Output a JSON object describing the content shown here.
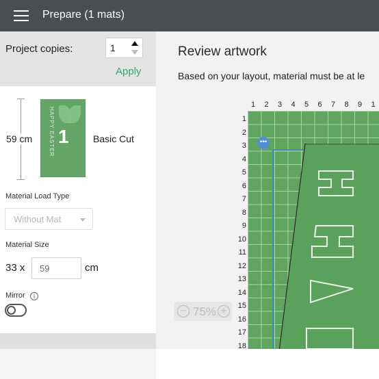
{
  "topbar": {
    "title": "Prepare (1 mats)",
    "menu_icon": "hamburger-menu-icon"
  },
  "left": {
    "copies_label": "Project copies:",
    "copies_value": "1",
    "apply_label": "Apply",
    "mat_length": "59 cm",
    "mat_number": "1",
    "mat_artwork_text": "HAPPY EASTER",
    "cut_type": "Basic Cut",
    "material_load_type_label": "Material Load Type",
    "material_load_type_value": "Without Mat",
    "material_size_label": "Material Size",
    "material_width": "33 x",
    "material_length_value": "59",
    "material_unit": "cm",
    "mirror_label": "Mirror",
    "mirror_on": false
  },
  "right": {
    "title": "Review artwork",
    "subtitle": "Based on your layout, material must be at le",
    "columns": [
      "1",
      "2",
      "3",
      "4",
      "5",
      "6",
      "7",
      "8",
      "9",
      "1"
    ],
    "rows": [
      "1",
      "2",
      "3",
      "4",
      "5",
      "6",
      "7",
      "8",
      "9",
      "10",
      "11",
      "12",
      "13",
      "14",
      "15",
      "16",
      "17",
      "18"
    ],
    "zoom_minus": "−",
    "zoom_plus": "+",
    "zoom_value": "75%",
    "mat_color": "#5fa560"
  }
}
